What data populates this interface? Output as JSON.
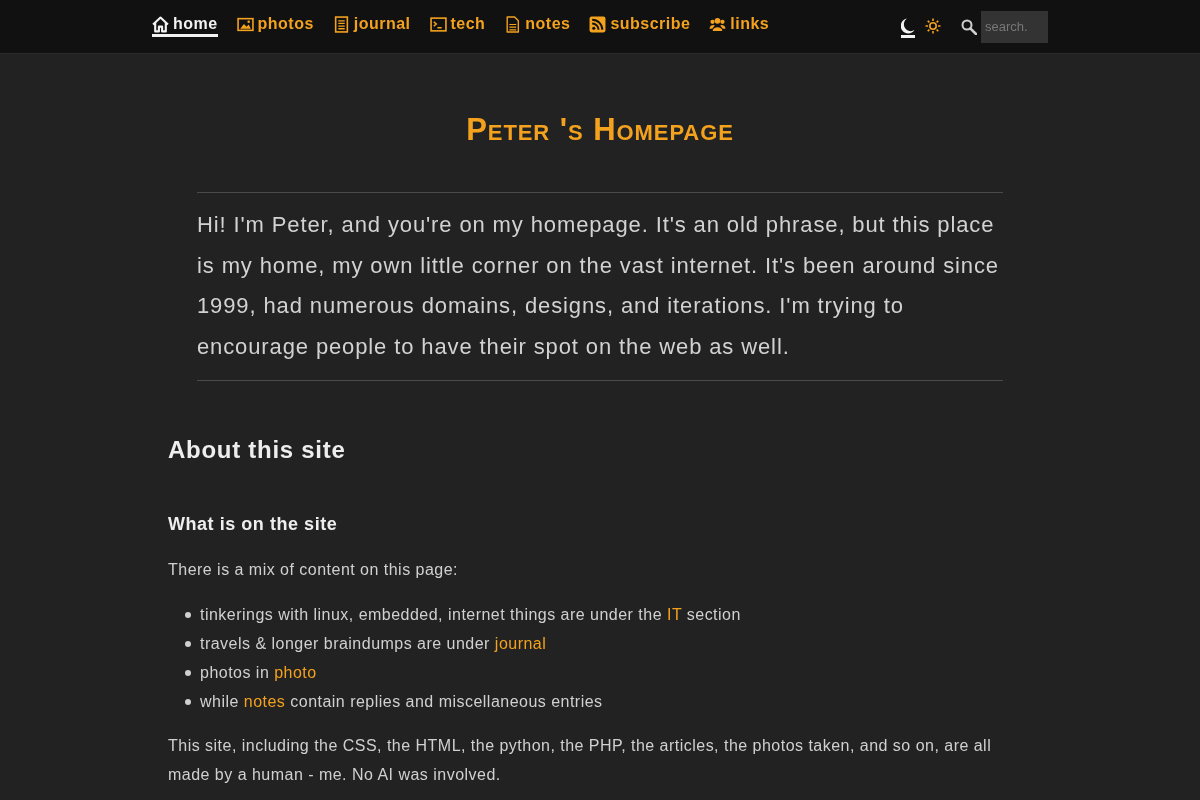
{
  "nav": {
    "items": [
      {
        "label": "home",
        "selected": true
      },
      {
        "label": "photos",
        "selected": false
      },
      {
        "label": "journal",
        "selected": false
      },
      {
        "label": "tech",
        "selected": false
      },
      {
        "label": "notes",
        "selected": false
      },
      {
        "label": "subscribe",
        "selected": false
      },
      {
        "label": "links",
        "selected": false
      }
    ],
    "theme_options": [
      {
        "selected": true
      },
      {
        "selected": false
      }
    ],
    "search": {
      "placeholder": "search."
    }
  },
  "title": "Peter 's Homepage",
  "intro": "Hi! I'm Peter, and you're on my homepage. It's an old phrase, but this place is my home, my own little corner on the vast internet. It's been around since 1999, had numerous domains, designs, and iterations. I'm trying to encourage people to have their spot on the web as well.",
  "about": {
    "heading": "About this site",
    "subheading": "What is on the site",
    "lead": "There is a mix of content on this page:",
    "list": [
      {
        "before": "tinkerings with linux, embedded, internet things are under the ",
        "link": "IT",
        "after": " section"
      },
      {
        "before": "travels & longer braindumps are under ",
        "link": "journal"
      },
      {
        "before": "photos in ",
        "link": "photo"
      },
      {
        "before": "while ",
        "link": "notes",
        "after": " contain replies and miscellaneous entries"
      }
    ],
    "closing": "This site, including the CSS, the HTML, the python, the PHP, the articles, the photos taken, and so on, are all made by a human - me. No AI was involved."
  }
}
